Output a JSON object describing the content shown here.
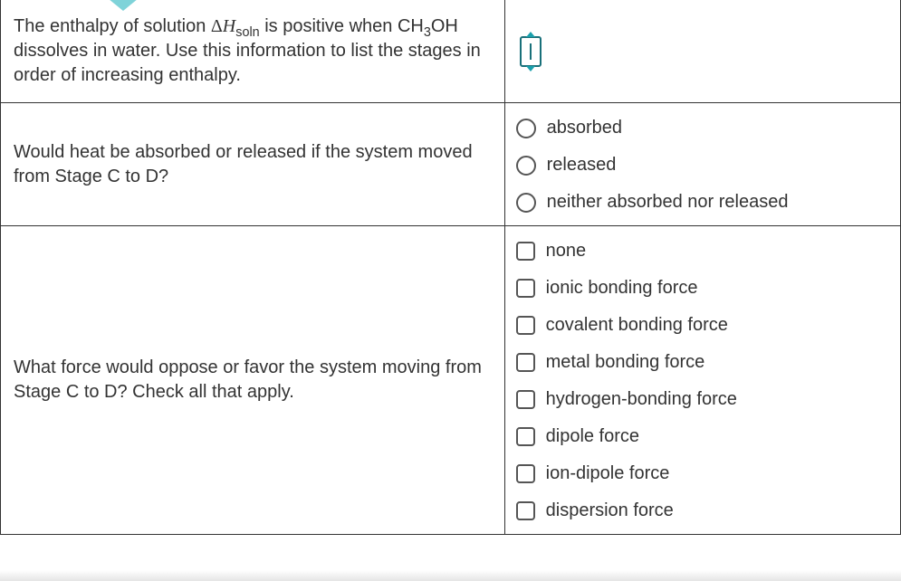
{
  "row1": {
    "question_parts": {
      "p1": "The enthalpy of solution ",
      "dh_delta": "Δ",
      "dh_H": "H",
      "dh_sub": "soln",
      "p2": " is positive when ",
      "chem_a": "CH",
      "chem_sub": "3",
      "chem_b": "OH",
      "p3": " dissolves in water. Use this information to list the stages in order of increasing enthalpy."
    }
  },
  "row2": {
    "question": "Would heat be absorbed or released if the system moved from Stage C to D?",
    "type": "radio",
    "options": [
      "absorbed",
      "released",
      "neither absorbed nor released"
    ]
  },
  "row3": {
    "question": "What force would oppose or favor the system moving from Stage C to D? Check all that apply.",
    "type": "checkbox",
    "options": [
      "none",
      "ionic bonding force",
      "covalent bonding force",
      "metal bonding force",
      "hydrogen-bonding force",
      "dipole force",
      "ion-dipole force",
      "dispersion force"
    ]
  }
}
